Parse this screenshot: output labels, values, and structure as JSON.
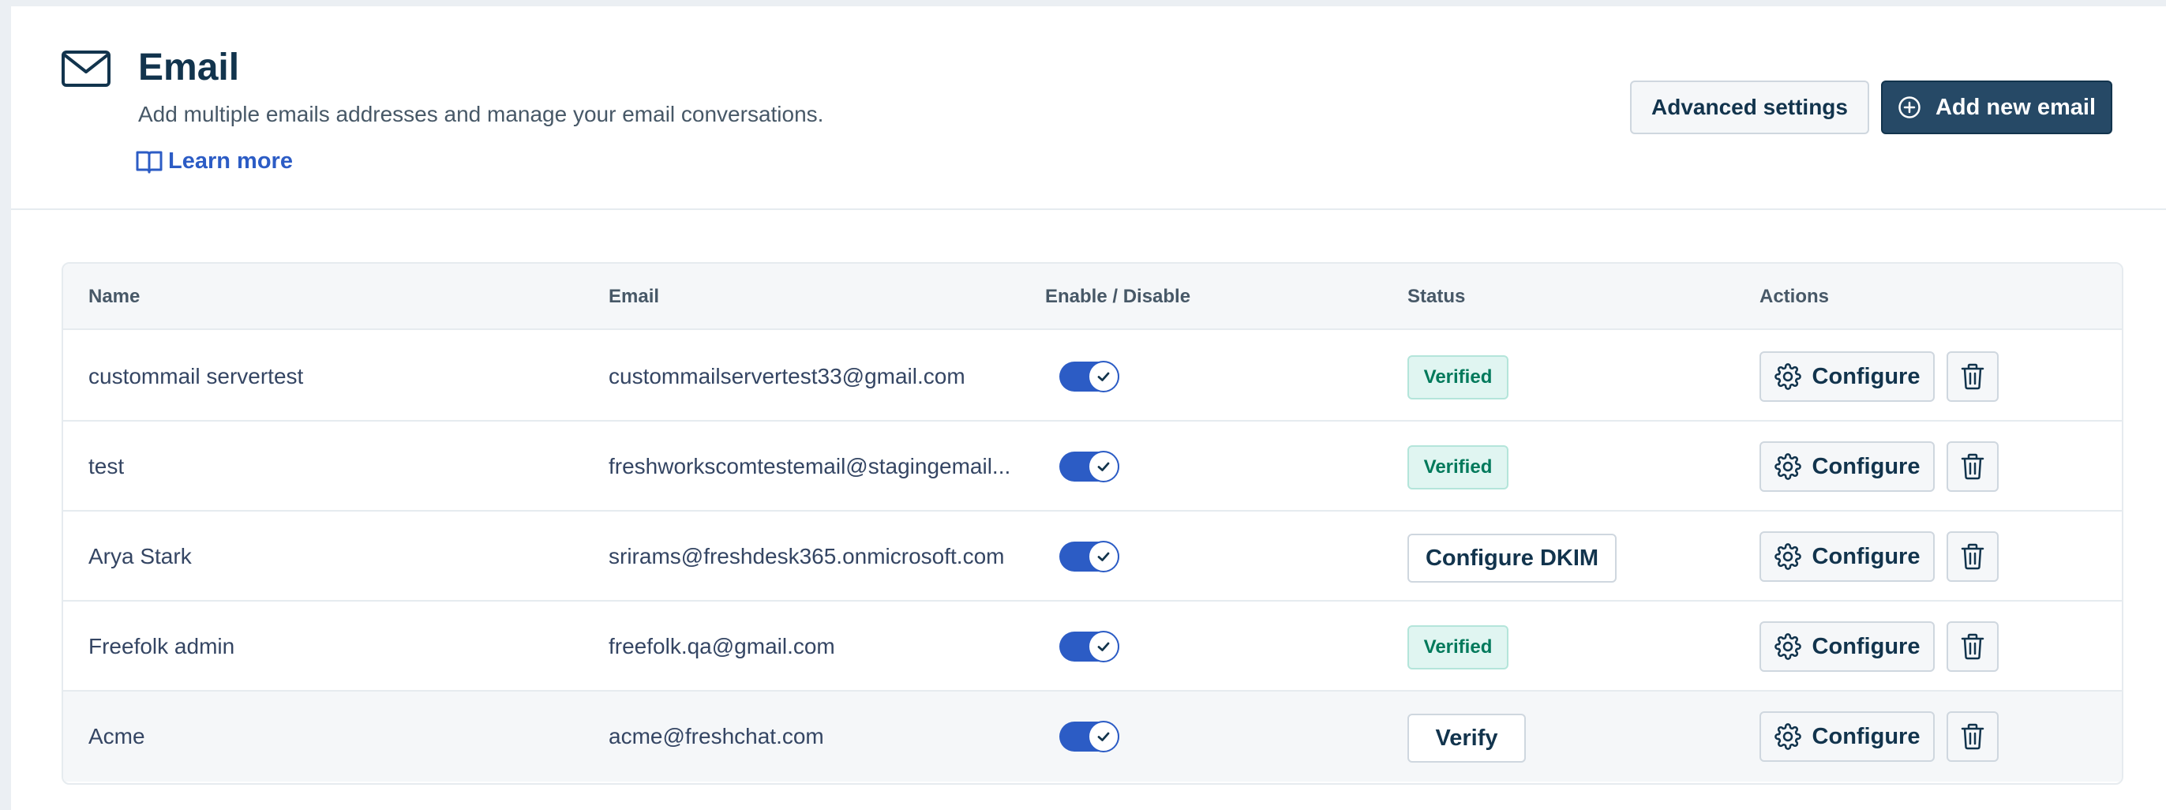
{
  "header": {
    "icon": "envelope-icon",
    "title": "Email",
    "subtitle": "Add multiple emails addresses and manage your email conversations.",
    "learn_more": {
      "icon": "book-icon",
      "label": "Learn more"
    },
    "advanced_settings_label": "Advanced settings",
    "add_new_email": {
      "icon": "plus-circle-icon",
      "label": "Add new email"
    }
  },
  "table": {
    "columns": [
      "Name",
      "Email",
      "Enable / Disable",
      "Status",
      "Actions"
    ],
    "rows": [
      {
        "name": "custommail servertest",
        "email": "custommailservertest33@gmail.com",
        "enabled": true,
        "status": "Verified",
        "status_type": "badge",
        "configure_label": "Configure"
      },
      {
        "name": "test",
        "email": "freshworkscomtestemail@stagingemail...",
        "enabled": true,
        "status": "Verified",
        "status_type": "badge",
        "configure_label": "Configure"
      },
      {
        "name": "Arya Stark",
        "email": "srirams@freshdesk365.onmicrosoft.com",
        "enabled": true,
        "status": "Configure DKIM",
        "status_type": "button",
        "configure_label": "Configure"
      },
      {
        "name": "Freefolk admin",
        "email": "freefolk.qa@gmail.com",
        "enabled": true,
        "status": "Verified",
        "status_type": "badge",
        "configure_label": "Configure"
      },
      {
        "name": "Acme",
        "email": "acme@freshchat.com",
        "enabled": true,
        "status": "Verify",
        "status_type": "button",
        "configure_label": "Configure"
      }
    ]
  },
  "colors": {
    "primary_button": "#264966",
    "link": "#2c5cc5",
    "toggle_on": "#2c5cc5",
    "verified_bg": "#e0f5f1",
    "verified_text": "#00795b"
  }
}
